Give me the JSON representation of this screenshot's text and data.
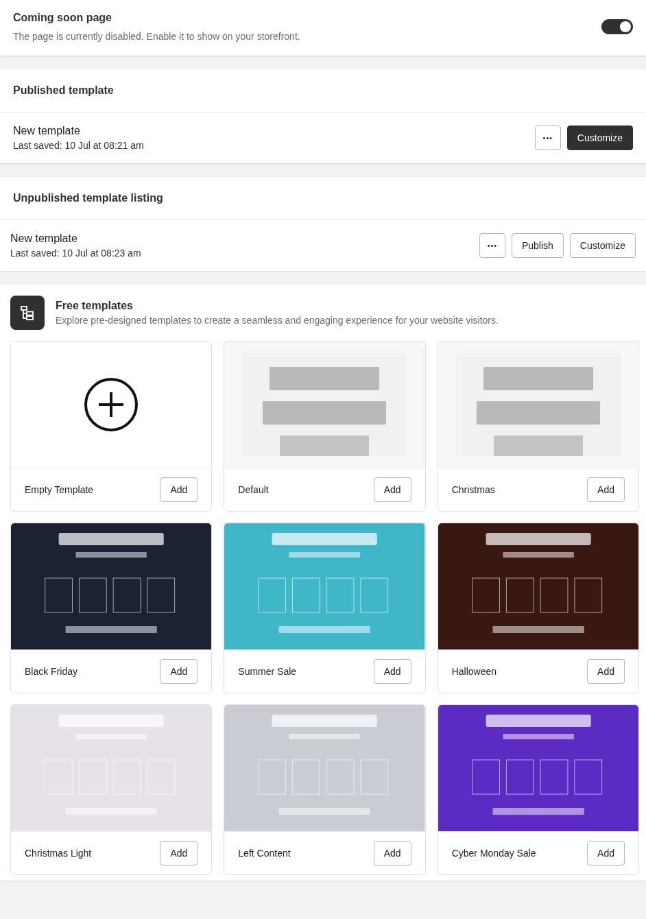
{
  "coming_soon": {
    "title": "Coming soon page",
    "description": "The page is currently disabled. Enable it to show on your storefront.",
    "toggle": {
      "on": true
    }
  },
  "published": {
    "title": "Published template",
    "item": {
      "name": "New template",
      "saved": "Last saved: 10 Jul at 08:21 am",
      "buttons": [
        {
          "kind": "more",
          "label": "•••"
        },
        {
          "kind": "primary",
          "label": "Customize"
        }
      ]
    }
  },
  "unpublished": {
    "title": "Unpublished template listing",
    "item": {
      "name": "New template",
      "saved": "Last saved: 10 Jul at 08:23 am",
      "buttons": [
        {
          "kind": "more",
          "label": "•••"
        },
        {
          "kind": "secondary",
          "label": "Publish"
        },
        {
          "kind": "secondary",
          "label": "Customize"
        }
      ]
    }
  },
  "free_templates": {
    "title": "Free templates",
    "description": "Explore pre-designed templates to create a seamless and engaging experience for your website visitors.",
    "templates": [
      {
        "name": "Empty Template",
        "kind": "empty",
        "button": "Add"
      },
      {
        "name": "Default",
        "kind": "placeholder",
        "button": "Add"
      },
      {
        "name": "Christmas",
        "kind": "placeholder",
        "button": "Add"
      },
      {
        "name": "Black Friday",
        "kind": "preview",
        "color": "#1b2233",
        "button": "Add"
      },
      {
        "name": "Summer Sale",
        "kind": "preview",
        "color": "#3fb7c9",
        "button": "Add"
      },
      {
        "name": "Halloween",
        "kind": "preview",
        "color": "#3a1812",
        "button": "Add"
      },
      {
        "name": "Christmas Light",
        "kind": "preview",
        "color": "#e6e2e8",
        "button": "Add"
      },
      {
        "name": "Left Content",
        "kind": "preview",
        "color": "#c9ccd3",
        "button": "Add"
      },
      {
        "name": "Cyber Monday Sale",
        "kind": "preview",
        "color": "#5b2bc4",
        "button": "Add"
      }
    ]
  }
}
